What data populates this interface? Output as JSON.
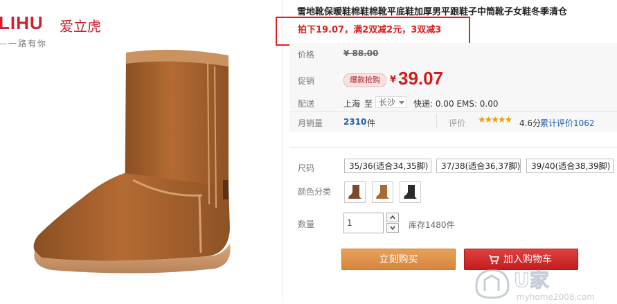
{
  "brand": {
    "logo_mark": "LIHU",
    "logo_cn": "爱立虎",
    "slogan": "一路有你"
  },
  "product": {
    "title": "雪地靴保暖鞋棉鞋棉靴平底鞋加厚男平跟鞋子中筒靴子女鞋冬季清仓",
    "promo": "拍下19.07，满2双减2元，3双减3"
  },
  "price": {
    "label": "价格",
    "original": "¥ 88.00"
  },
  "promotion": {
    "label": "促销",
    "badge": "爆款抢购",
    "yen": "¥",
    "value": "39.07"
  },
  "shipping": {
    "label": "配送",
    "from": "上海",
    "to_text": "至",
    "city": "长沙",
    "express": "快递: 0.00 EMS: 0.00"
  },
  "sales": {
    "label": "月销量",
    "count": "2310",
    "unit": "件",
    "review_label": "评价",
    "stars": "★★★★★",
    "rating": "4.6分",
    "review_link": "累计评价1062"
  },
  "size": {
    "label": "尺码",
    "options": [
      "35/36(适合34,35脚)",
      "37/38(适合36,37脚)",
      "39/40(适合38,39脚)"
    ]
  },
  "color": {
    "label": "颜色分类",
    "swatches": [
      "#7a4a2a",
      "#a96a35",
      "#2a2a2a"
    ]
  },
  "quantity": {
    "label": "数量",
    "value": "1",
    "stock": "库存1480件"
  },
  "actions": {
    "buy_now": "立刻购买",
    "add_cart": "加入购物车"
  },
  "watermark": {
    "text": "U家",
    "url": "myhome2008.com"
  },
  "colors": {
    "accent_red": "#d21a1a",
    "link_blue": "#1f5fb4",
    "buy_orange": "#dd8f45",
    "cart_red": "#d02828"
  }
}
